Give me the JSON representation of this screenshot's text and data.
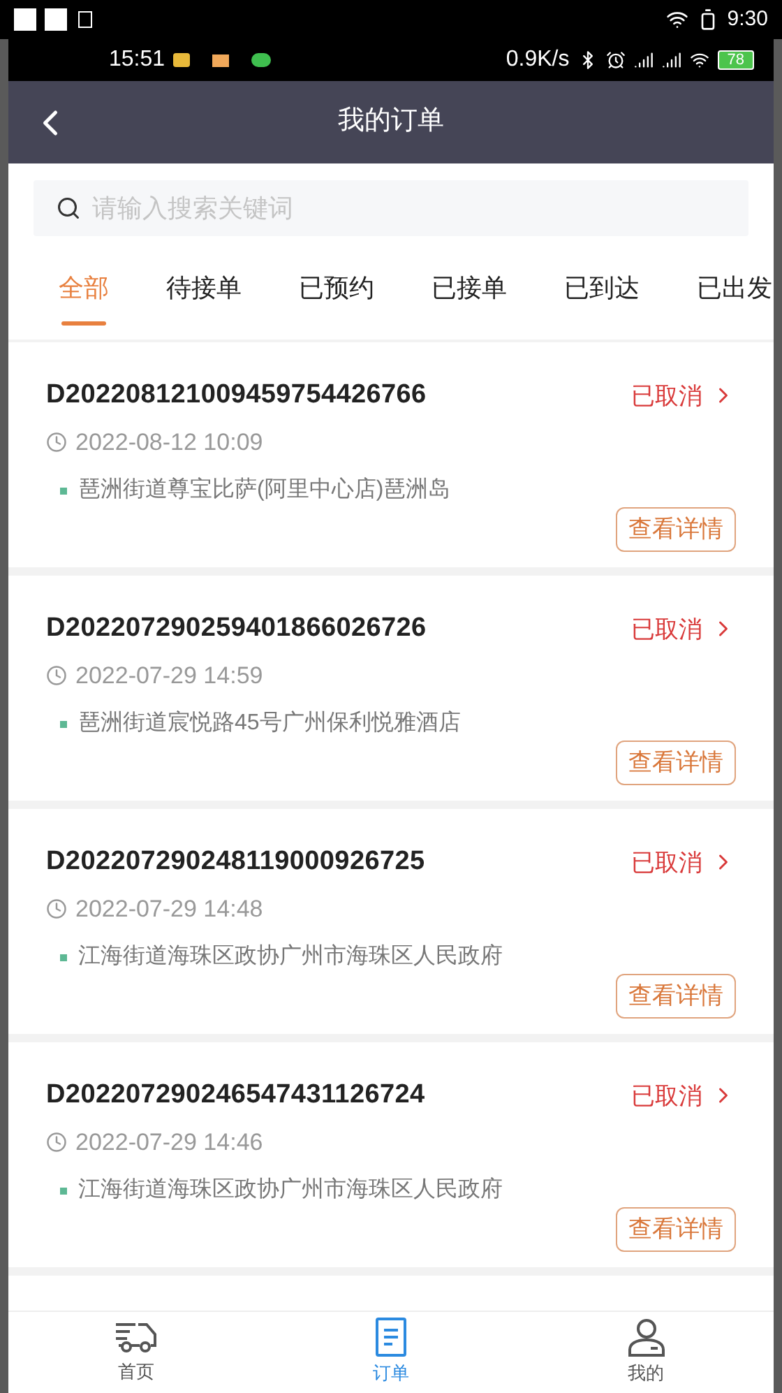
{
  "system_bar": {
    "time": "9:30"
  },
  "phone_status": {
    "time": "15:51",
    "speed": "0.9K/s",
    "battery": "78"
  },
  "header": {
    "title": "我的订单"
  },
  "search": {
    "placeholder": "请输入搜索关键词"
  },
  "tabs": [
    {
      "label": "全部",
      "selected": true
    },
    {
      "label": "待接单",
      "selected": false
    },
    {
      "label": "已预约",
      "selected": false
    },
    {
      "label": "已接单",
      "selected": false
    },
    {
      "label": "已到达",
      "selected": false
    },
    {
      "label": "已出发",
      "selected": false
    }
  ],
  "orders": [
    {
      "number": "D202208121009459754426766",
      "status": "已取消",
      "time": "2022-08-12 10:09",
      "address": "琶洲街道尊宝比萨(阿里中心店)琶洲岛",
      "action": "查看详情"
    },
    {
      "number": "D202207290259401866026726",
      "status": "已取消",
      "time": "2022-07-29 14:59",
      "address": "琶洲街道宸悦路45号广州保利悦雅酒店",
      "action": "查看详情"
    },
    {
      "number": "D202207290248119000926725",
      "status": "已取消",
      "time": "2022-07-29 14:48",
      "address": "江海街道海珠区政协广州市海珠区人民政府",
      "action": "查看详情"
    },
    {
      "number": "D202207290246547431126724",
      "status": "已取消",
      "time": "2022-07-29 14:46",
      "address": "江海街道海珠区政协广州市海珠区人民政府",
      "action": "查看详情"
    }
  ],
  "nav": [
    {
      "label": "首页",
      "kind": "home",
      "selected": false
    },
    {
      "label": "订单",
      "kind": "orders",
      "selected": true
    },
    {
      "label": "我的",
      "kind": "profile",
      "selected": false
    }
  ]
}
